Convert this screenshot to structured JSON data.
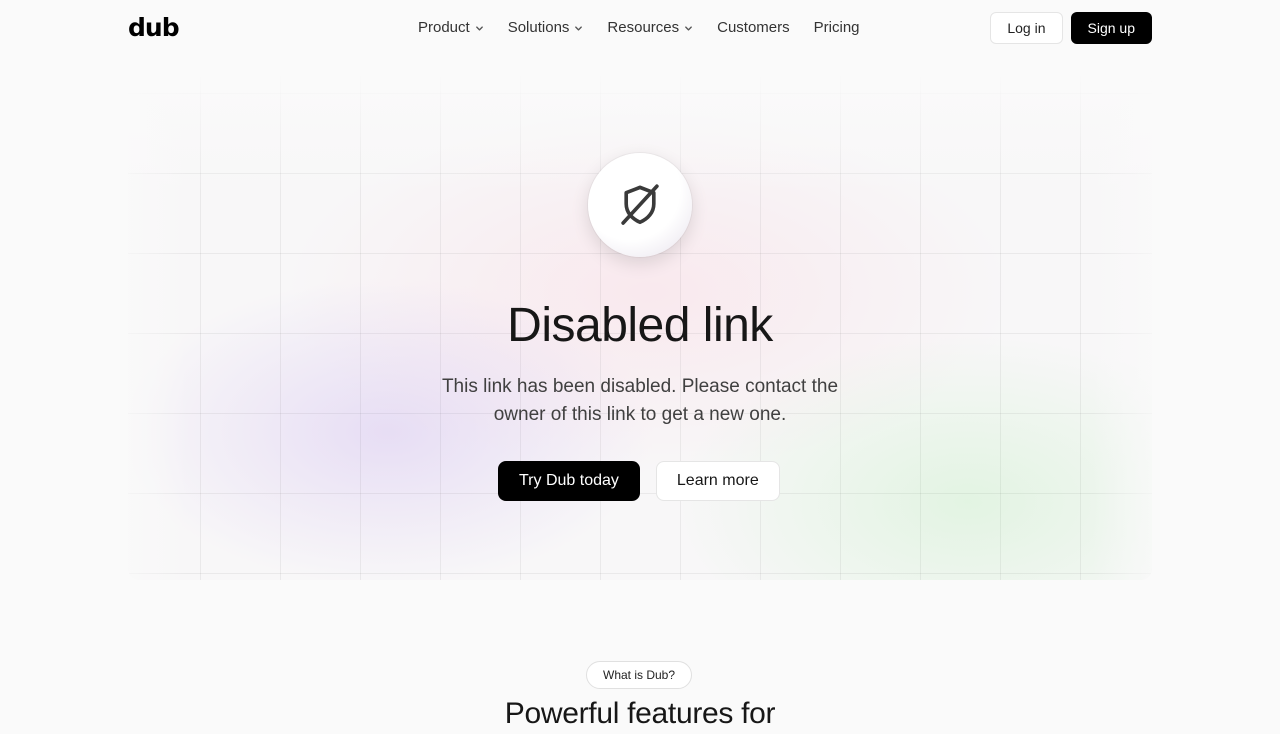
{
  "nav": {
    "logo": "dub",
    "menu": [
      {
        "label": "Product",
        "has_dropdown": true
      },
      {
        "label": "Solutions",
        "has_dropdown": true
      },
      {
        "label": "Resources",
        "has_dropdown": true
      },
      {
        "label": "Customers",
        "has_dropdown": false
      },
      {
        "label": "Pricing",
        "has_dropdown": false
      }
    ],
    "login_label": "Log in",
    "signup_label": "Sign up"
  },
  "hero": {
    "icon": "shield-off-icon",
    "title": "Disabled link",
    "subtitle": "This link has been disabled. Please contact the owner of this link to get a new one.",
    "primary_cta": "Try Dub today",
    "secondary_cta": "Learn more"
  },
  "section": {
    "pill_label": "What is Dub?",
    "title": "Powerful features for"
  },
  "colors": {
    "background": "#fafafa",
    "primary_button": "#000000",
    "text": "#171717"
  }
}
